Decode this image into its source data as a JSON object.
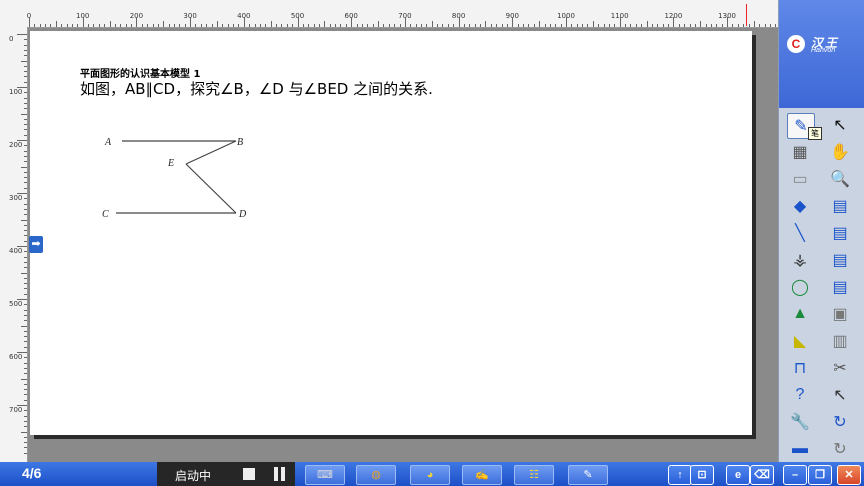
{
  "ruler": {
    "top_marks": [
      "0",
      "100",
      "200",
      "300",
      "400",
      "500",
      "600",
      "700",
      "800",
      "900",
      "1000",
      "1100",
      "1200",
      "1300"
    ],
    "left_marks": [
      "0",
      "100",
      "200",
      "300",
      "400",
      "500",
      "600",
      "700"
    ]
  },
  "slide": {
    "subtitle": "平面图形的认识基本模型 1",
    "problem": "如图，AB∥CD，探究∠B，∠D 与∠BED 之间的关系.",
    "figure_labels": {
      "A": "A",
      "B": "B",
      "C": "C",
      "D": "D",
      "E": "E"
    }
  },
  "sidepanel": {
    "brand_mark": "C",
    "brand_name": "汉王",
    "brand_en": "Hanvon",
    "tooltip": "笔",
    "tools": [
      {
        "name": "pen-icon",
        "glyph": "✎",
        "color": "#1b54c9",
        "selected": true
      },
      {
        "name": "pointer-icon",
        "glyph": "↖",
        "color": "#111"
      },
      {
        "name": "fill-pattern-icon",
        "glyph": "▦",
        "color": "#555"
      },
      {
        "name": "hand-icon",
        "glyph": "✋",
        "color": "#555"
      },
      {
        "name": "eraser-icon",
        "glyph": "▭",
        "color": "#888"
      },
      {
        "name": "magnifier-icon",
        "glyph": "🔍",
        "color": "#1b8a3a"
      },
      {
        "name": "paint-bucket-icon",
        "glyph": "◆",
        "color": "#1b54c9"
      },
      {
        "name": "new-page-icon",
        "glyph": "▤",
        "color": "#1b54c9"
      },
      {
        "name": "line-icon",
        "glyph": "╲",
        "color": "#1b54c9"
      },
      {
        "name": "delete-page-icon",
        "glyph": "▤",
        "color": "#1b54c9"
      },
      {
        "name": "compass-icon",
        "glyph": "⚶",
        "color": "#333"
      },
      {
        "name": "page-down-icon",
        "glyph": "▤",
        "color": "#1b54c9"
      },
      {
        "name": "shapes-icon",
        "glyph": "◯",
        "color": "#1b8a3a"
      },
      {
        "name": "page-up-icon",
        "glyph": "▤",
        "color": "#1b54c9"
      },
      {
        "name": "3d-shapes-icon",
        "glyph": "▲",
        "color": "#1b8a3a"
      },
      {
        "name": "screenshot-icon",
        "glyph": "▣",
        "color": "#777"
      },
      {
        "name": "triangle-ruler-icon",
        "glyph": "◣",
        "color": "#c7b600"
      },
      {
        "name": "paste-icon",
        "glyph": "▥",
        "color": "#777"
      },
      {
        "name": "protractor-icon",
        "glyph": "⊓",
        "color": "#1b54c9"
      },
      {
        "name": "scissors-icon",
        "glyph": "✂",
        "color": "#555"
      },
      {
        "name": "help-icon",
        "glyph": "?",
        "color": "#1b54c9"
      },
      {
        "name": "select-area-icon",
        "glyph": "↖",
        "color": "#333"
      },
      {
        "name": "settings-tool-icon",
        "glyph": "🔧",
        "color": "#1b54c9"
      },
      {
        "name": "back-icon",
        "glyph": "↻",
        "color": "#1b54c9"
      },
      {
        "name": "folder-icon",
        "glyph": "▬",
        "color": "#1b54c9"
      },
      {
        "name": "forward-icon",
        "glyph": "↻",
        "color": "#777"
      }
    ]
  },
  "taskbar": {
    "page_counter": "4/6",
    "status": "启动中",
    "tasks": [
      {
        "name": "task-keyboard-icon",
        "glyph": "⌨",
        "color": "#ddd"
      },
      {
        "name": "task-database-icon",
        "glyph": "◍",
        "color": "#e7a22a"
      },
      {
        "name": "task-paint-icon",
        "glyph": "◕",
        "color": "#f4d23a"
      },
      {
        "name": "task-write-icon",
        "glyph": "✍",
        "color": "#fff"
      },
      {
        "name": "task-book-icon",
        "glyph": "☷",
        "color": "#f4d23a"
      },
      {
        "name": "task-edit-icon",
        "glyph": "✎",
        "color": "#fff"
      }
    ],
    "window_buttons": [
      {
        "name": "up-icon",
        "glyph": "↑"
      },
      {
        "name": "lock-icon",
        "glyph": "⊡"
      },
      {
        "name": "ie-icon",
        "glyph": "e"
      },
      {
        "name": "tool-icon",
        "glyph": "⌫"
      },
      {
        "name": "minimize-icon",
        "glyph": "–"
      },
      {
        "name": "restore-icon",
        "glyph": "❐"
      },
      {
        "name": "close-icon",
        "glyph": "✕"
      }
    ]
  }
}
